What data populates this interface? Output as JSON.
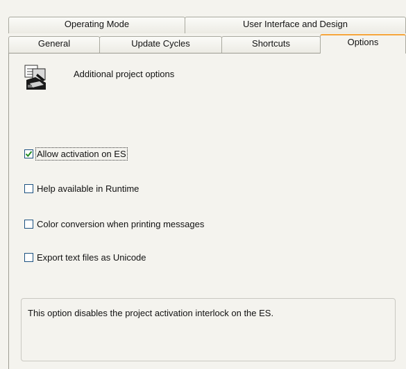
{
  "tabs_row_back": [
    {
      "label": "Operating Mode"
    },
    {
      "label": "User Interface and Design"
    }
  ],
  "tabs_row_front": [
    {
      "label": "General"
    },
    {
      "label": "Update Cycles"
    },
    {
      "label": "Shortcuts"
    },
    {
      "label": "Options",
      "active": true
    }
  ],
  "options_page": {
    "icon": "project-options-icon",
    "title": "Additional project options",
    "checkboxes": [
      {
        "label": "Allow activation on ES",
        "checked": true,
        "focused": true
      },
      {
        "label": "Help available in Runtime",
        "checked": false
      },
      {
        "label": "Color conversion when printing messages",
        "checked": false
      },
      {
        "label": "Export text files as Unicode",
        "checked": false
      }
    ],
    "description": "This option disables the project activation interlock on the ES."
  },
  "colors": {
    "active_tab_accent": "#f6a53a",
    "checkbox_border": "#1c5180",
    "checkmark": "#1e8a1e",
    "panel_background": "#f4f3ee"
  }
}
